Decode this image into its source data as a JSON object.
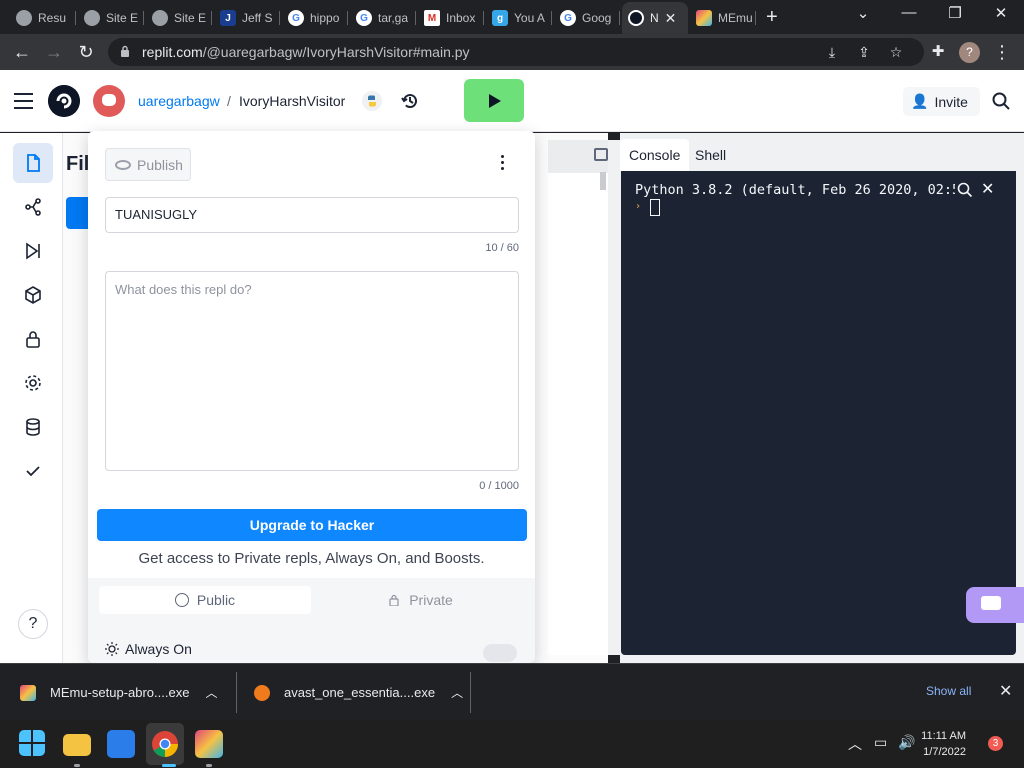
{
  "browser": {
    "tabs": [
      {
        "label": "Resu",
        "icon": "globe-icon",
        "color": "#9aa0a6"
      },
      {
        "label": "Site E",
        "icon": "globe-icon",
        "color": "#9aa0a6"
      },
      {
        "label": "Site E",
        "icon": "globe-icon",
        "color": "#9aa0a6"
      },
      {
        "label": "Jeff S",
        "icon": "j-icon",
        "color": "#1a3d8f"
      },
      {
        "label": "hippo",
        "icon": "google-icon",
        "color": "#ffffff"
      },
      {
        "label": "tar,ga",
        "icon": "google-icon",
        "color": "#ffffff"
      },
      {
        "label": "Inbox",
        "icon": "gmail-icon",
        "color": "#ffffff"
      },
      {
        "label": "You A",
        "icon": "g-icon",
        "color": "#35a7e8"
      },
      {
        "label": "Goog",
        "icon": "google-icon",
        "color": "#ffffff"
      },
      {
        "label": "N",
        "icon": "replit-icon",
        "color": "#ffffff",
        "active": true
      },
      {
        "label": "MEmu",
        "icon": "memu-icon",
        "color": "#ffffff"
      }
    ],
    "url_host": "replit.com",
    "url_path": "/@uaregarbagw/IvoryHarshVisitor#main.py",
    "profile_initial": "?"
  },
  "header": {
    "username": "uaregarbagw",
    "separator": "/",
    "repl_name": "IvoryHarshVisitor",
    "invite_label": "Invite",
    "run_color": "#6ee07a"
  },
  "files": {
    "title": "Fil"
  },
  "publish": {
    "publish_label": "Publish",
    "title_value": "TUANISUGLY",
    "title_counter": "10 / 60",
    "description_placeholder": "What does this repl do?",
    "description_counter": "0 / 1000",
    "upgrade_label": "Upgrade to Hacker",
    "upgrade_subtext": "Get access to Private repls, Always On, and Boosts.",
    "public_label": "Public",
    "private_label": "Private",
    "always_on_label": "Always On"
  },
  "console": {
    "tab_console": "Console",
    "tab_shell": "Shell",
    "python_banner": "Python 3.8.2 (default, Feb 26 2020, 02:5",
    "prompt_symbol": "›"
  },
  "downloads": {
    "items": [
      {
        "name": "MEmu-setup-abro....exe",
        "icon_color": "#e1457a"
      },
      {
        "name": "avast_one_essentia....exe",
        "icon_color": "#f07b1d"
      }
    ],
    "show_all": "Show all"
  },
  "taskbar": {
    "time": "11:11 AM",
    "date": "1/7/2022",
    "notifications": "3"
  }
}
